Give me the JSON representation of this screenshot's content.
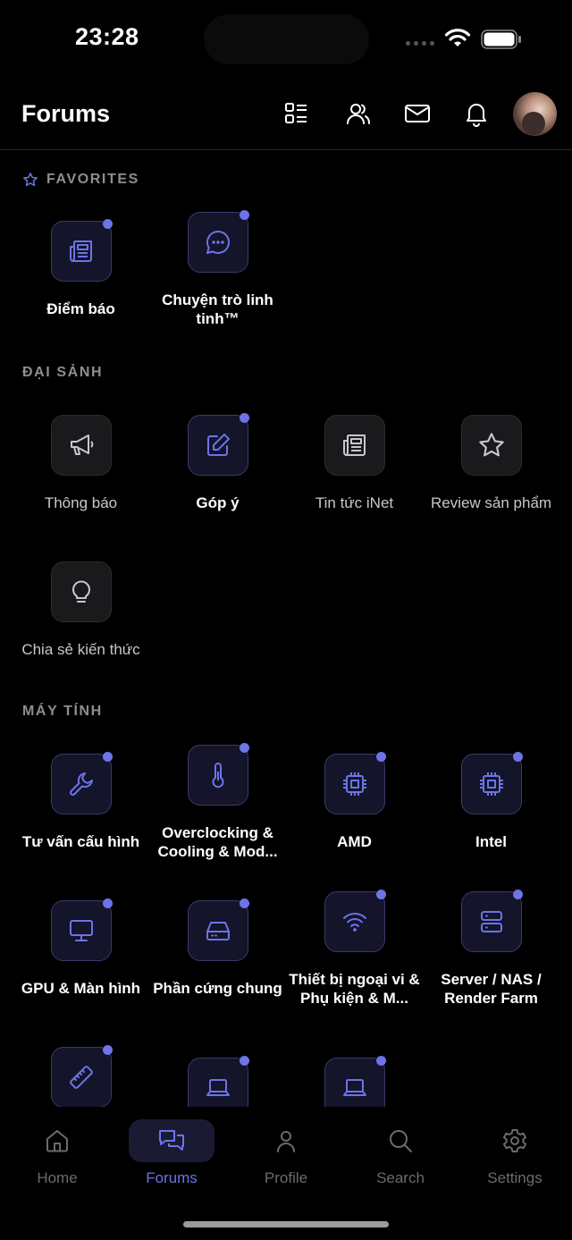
{
  "status_bar": {
    "time": "23:28"
  },
  "header": {
    "title": "Forums"
  },
  "sections": {
    "favorites": {
      "title": "FAVORITES",
      "items": [
        {
          "label": "Điểm báo",
          "icon": "newspaper-icon",
          "unread": true
        },
        {
          "label": "Chuyện trò linh tinh™",
          "icon": "chat-bubble-icon",
          "unread": true
        }
      ]
    },
    "dai_sanh": {
      "title": "ĐẠI SẢNH",
      "items": [
        {
          "label": "Thông báo",
          "icon": "megaphone-icon",
          "unread": false
        },
        {
          "label": "Góp ý",
          "icon": "edit-icon",
          "unread": true
        },
        {
          "label": "Tin tức iNet",
          "icon": "newspaper-icon",
          "unread": false
        },
        {
          "label": "Review sản phẩm",
          "icon": "star-icon",
          "unread": false
        },
        {
          "label": "Chia sẻ kiến thức",
          "icon": "lightbulb-icon",
          "unread": false
        }
      ]
    },
    "may_tinh": {
      "title": "MÁY TÍNH",
      "items": [
        {
          "label": "Tư vấn cấu hình",
          "icon": "wrench-icon",
          "unread": true
        },
        {
          "label": "Overclocking & Cooling & Mod...",
          "icon": "thermometer-icon",
          "unread": true
        },
        {
          "label": "AMD",
          "icon": "cpu-icon",
          "unread": true
        },
        {
          "label": "Intel",
          "icon": "cpu-icon",
          "unread": true
        },
        {
          "label": "GPU & Màn hình",
          "icon": "monitor-icon",
          "unread": true
        },
        {
          "label": "Phần cứng chung",
          "icon": "hard-drive-icon",
          "unread": true
        },
        {
          "label": "Thiết bị ngoại vi & Phụ kiện & M...",
          "icon": "wifi-icon",
          "unread": true
        },
        {
          "label": "Server / NAS / Render Farm",
          "icon": "server-icon",
          "unread": true
        },
        {
          "label": "",
          "icon": "ruler-icon",
          "unread": true
        },
        {
          "label": "",
          "icon": "laptop-icon",
          "unread": true
        },
        {
          "label": "",
          "icon": "laptop-icon",
          "unread": true
        }
      ]
    }
  },
  "tabbar": {
    "items": [
      {
        "label": "Home",
        "icon": "home-icon",
        "selected": false
      },
      {
        "label": "Forums",
        "icon": "forums-icon",
        "selected": true
      },
      {
        "label": "Profile",
        "icon": "profile-icon",
        "selected": false
      },
      {
        "label": "Search",
        "icon": "search-icon",
        "selected": false
      },
      {
        "label": "Settings",
        "icon": "gear-icon",
        "selected": false
      }
    ]
  },
  "colors": {
    "accent": "#6c74e6",
    "muted_text": "#6a6a70",
    "background": "#000000"
  }
}
